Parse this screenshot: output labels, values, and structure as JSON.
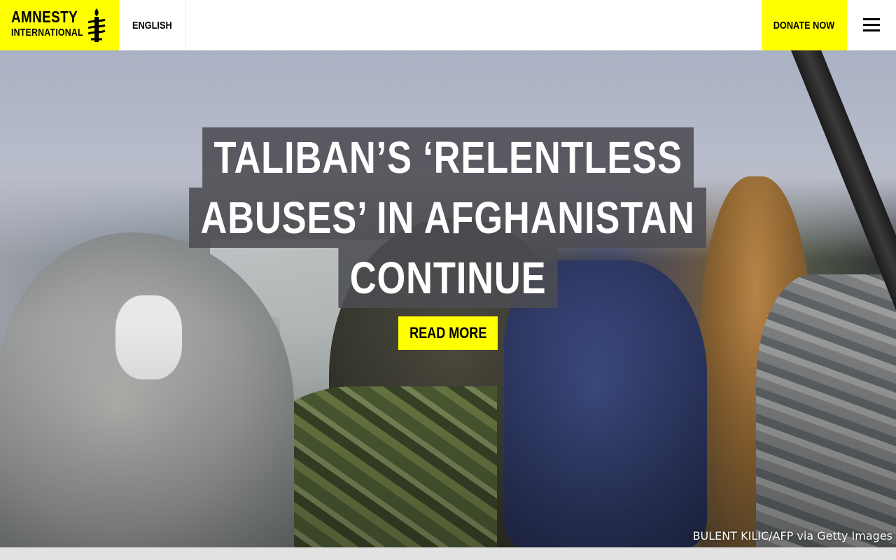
{
  "header": {
    "logo": {
      "line1": "AMNESTY",
      "line2": "INTERNATIONAL",
      "icon": "candle-barbed-wire-icon"
    },
    "language": "ENGLISH",
    "donate_label": "DONATE NOW",
    "menu_icon": "hamburger-menu-icon"
  },
  "hero": {
    "headline_lines": [
      "TALIBAN’S ‘RELENTLESS",
      "ABUSES’ IN AFGHANISTAN",
      "CONTINUE"
    ],
    "cta_label": "READ MORE",
    "photo_credit": "BULENT KILIC/AFP via Getty Images"
  },
  "colors": {
    "brand_yellow": "#ffff00",
    "headline_bg": "#4c4c52",
    "text_dark": "#000000"
  }
}
